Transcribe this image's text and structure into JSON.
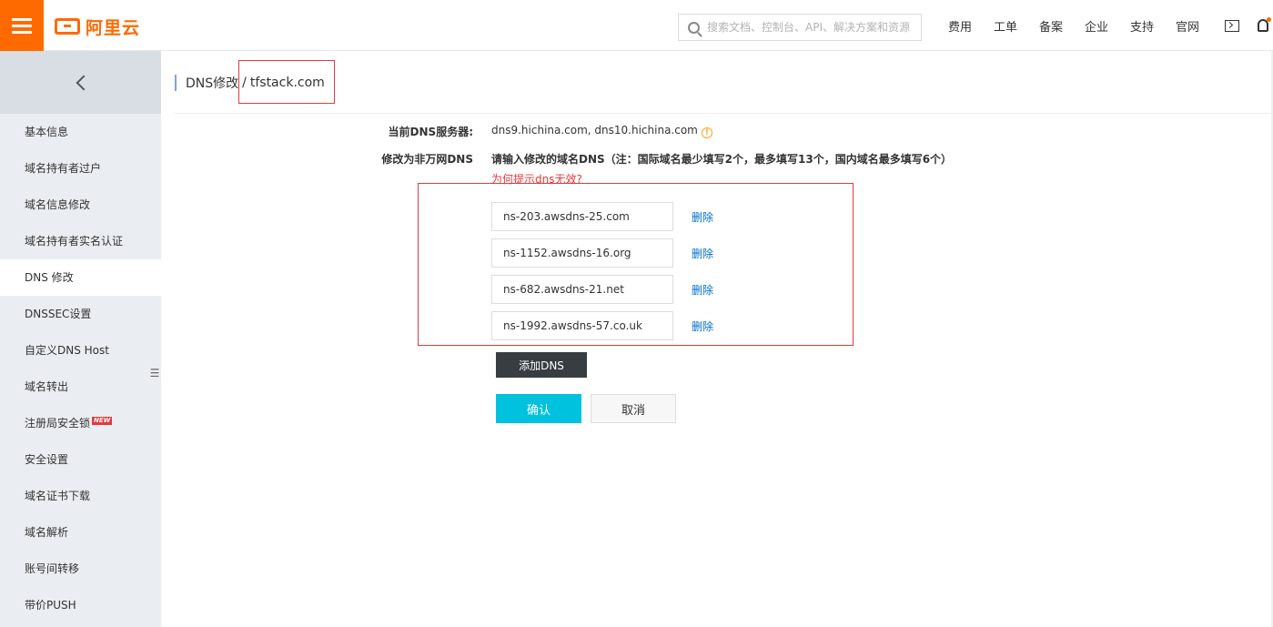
{
  "header": {
    "logo_text": "阿里云",
    "search_placeholder": "搜索文档、控制台、API、解决方案和资源",
    "nav": [
      "费用",
      "工单",
      "备案",
      "企业",
      "支持",
      "官网"
    ]
  },
  "sidebar": {
    "items": [
      {
        "label": "基本信息",
        "active": false
      },
      {
        "label": "域名持有者过户",
        "active": false
      },
      {
        "label": "域名信息修改",
        "active": false
      },
      {
        "label": "域名持有者实名认证",
        "active": false
      },
      {
        "label": "DNS 修改",
        "active": true
      },
      {
        "label": "DNSSEC设置",
        "active": false
      },
      {
        "label": "自定义DNS Host",
        "active": false
      },
      {
        "label": "域名转出",
        "active": false
      },
      {
        "label": "注册局安全锁",
        "active": false,
        "badge": "NEW"
      },
      {
        "label": "安全设置",
        "active": false
      },
      {
        "label": "域名证书下载",
        "active": false
      },
      {
        "label": "域名解析",
        "active": false
      },
      {
        "label": "账号间转移",
        "active": false
      },
      {
        "label": "带价PUSH",
        "active": false
      }
    ],
    "collapse_glyph": "☰"
  },
  "breadcrumb": {
    "parent": "DNS修改",
    "separator": "/",
    "current": "tfstack.com"
  },
  "form": {
    "current_dns_label": "当前DNS服务器:",
    "current_dns_value": "dns9.hichina.com, dns10.hichina.com",
    "info_glyph": "!",
    "modify_label": "修改为非万网DNS",
    "modify_hint": "请输入修改的域名DNS（注：国际域名最少填写2个，最多填写13个，国内域名最多填写6个）",
    "why_link": "为何提示dns无效?",
    "dns_entries": [
      "ns-203.awsdns-25.com",
      "ns-1152.awsdns-16.org",
      "ns-682.awsdns-21.net",
      "ns-1992.awsdns-57.co.uk"
    ],
    "delete_label": "删除",
    "add_button": "添加DNS",
    "confirm_button": "确认",
    "cancel_button": "取消"
  },
  "colors": {
    "brand": "#ff6a00",
    "highlight": "#e4393c",
    "link": "#0070cc",
    "confirm": "#00c1de",
    "dark_button": "#373d41"
  }
}
